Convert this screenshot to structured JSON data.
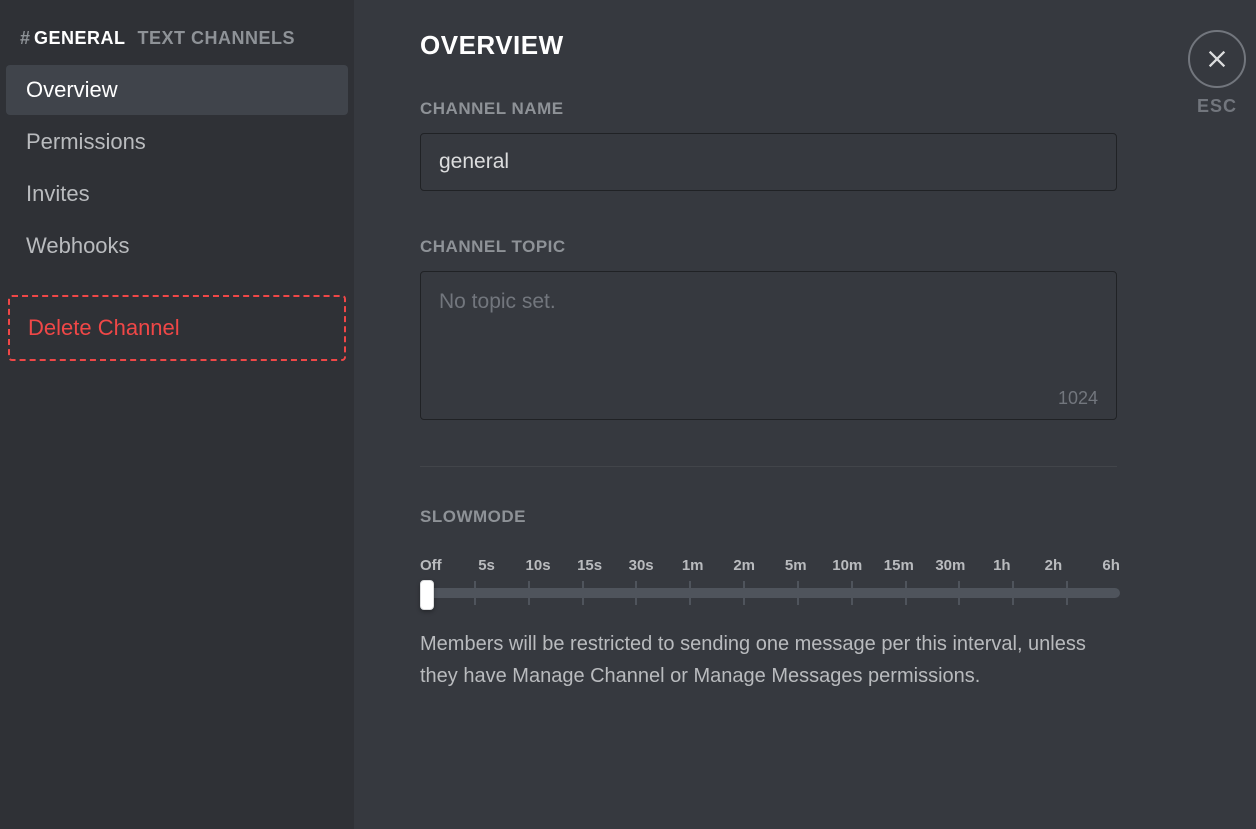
{
  "sidebar": {
    "hash": "#",
    "channel_name": "GENERAL",
    "category": "TEXT CHANNELS",
    "items": [
      {
        "label": "Overview",
        "active": true
      },
      {
        "label": "Permissions",
        "active": false
      },
      {
        "label": "Invites",
        "active": false
      },
      {
        "label": "Webhooks",
        "active": false
      }
    ],
    "delete_label": "Delete Channel"
  },
  "main": {
    "title": "OVERVIEW",
    "channel_name": {
      "label": "CHANNEL NAME",
      "value": "general"
    },
    "channel_topic": {
      "label": "CHANNEL TOPIC",
      "placeholder": "No topic set.",
      "char_limit": "1024"
    },
    "slowmode": {
      "label": "SLOWMODE",
      "ticks": [
        "Off",
        "5s",
        "10s",
        "15s",
        "30s",
        "1m",
        "2m",
        "5m",
        "10m",
        "15m",
        "30m",
        "1h",
        "2h",
        "6h"
      ],
      "help": "Members will be restricted to sending one message per this interval, unless they have Manage Channel or Manage Messages permissions."
    }
  },
  "close": {
    "esc_label": "ESC"
  }
}
